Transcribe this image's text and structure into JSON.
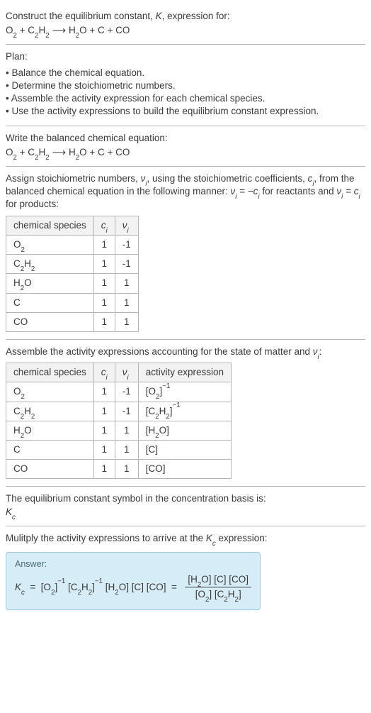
{
  "prompt": {
    "line1_a": "Construct the equilibrium constant, ",
    "line1_K": "K",
    "line1_b": ", expression for:"
  },
  "plan": {
    "heading": "Plan:",
    "items": [
      "Balance the chemical equation.",
      "Determine the stoichiometric numbers.",
      "Assemble the activity expression for each chemical species.",
      "Use the activity expressions to build the equilibrium constant expression."
    ]
  },
  "balanced_heading": "Write the balanced chemical equation:",
  "stoich": {
    "intro_a": "Assign stoichiometric numbers, ",
    "intro_b": ", using the stoichiometric coefficients, ",
    "intro_c": ", from the balanced chemical equation in the following manner: ",
    "intro_d": " for reactants and ",
    "intro_e": " for products:",
    "headers": {
      "species": "chemical species",
      "ci": "c",
      "vi": "ν"
    },
    "rows": [
      {
        "ci": "1",
        "vi": "-1",
        "kind": "O2"
      },
      {
        "ci": "1",
        "vi": "-1",
        "kind": "C2H2"
      },
      {
        "ci": "1",
        "vi": "1",
        "kind": "H2O"
      },
      {
        "ci": "1",
        "vi": "1",
        "kind": "C"
      },
      {
        "ci": "1",
        "vi": "1",
        "kind": "CO"
      }
    ]
  },
  "activity": {
    "intro_a": "Assemble the activity expressions accounting for the state of matter and ",
    "intro_b": ":",
    "headers": {
      "species": "chemical species",
      "ci": "c",
      "vi": "ν",
      "act": "activity expression"
    },
    "rows": [
      {
        "ci": "1",
        "vi": "-1"
      },
      {
        "ci": "1",
        "vi": "-1"
      },
      {
        "ci": "1",
        "vi": "1"
      },
      {
        "ci": "1",
        "vi": "1"
      },
      {
        "ci": "1",
        "vi": "1"
      }
    ]
  },
  "kc_intro": "The equilibrium constant symbol in the concentration basis is:",
  "multiply_intro_a": "Mulitply the activity expressions to arrive at the ",
  "multiply_intro_b": " expression:",
  "answer_label": "Answer:",
  "chart_data": {
    "type": "table",
    "title": "Stoichiometric numbers and activity expressions",
    "reaction": "O2 + C2H2 -> H2O + C + CO",
    "species": [
      {
        "name": "O2",
        "c_i": 1,
        "nu_i": -1,
        "activity_expression": "[O2]^(-1)"
      },
      {
        "name": "C2H2",
        "c_i": 1,
        "nu_i": -1,
        "activity_expression": "[C2H2]^(-1)"
      },
      {
        "name": "H2O",
        "c_i": 1,
        "nu_i": 1,
        "activity_expression": "[H2O]"
      },
      {
        "name": "C",
        "c_i": 1,
        "nu_i": 1,
        "activity_expression": "[C]"
      },
      {
        "name": "CO",
        "c_i": 1,
        "nu_i": 1,
        "activity_expression": "[CO]"
      }
    ],
    "Kc_expression": "K_c = [O2]^(-1) [C2H2]^(-1) [H2O] [C] [CO] = ([H2O][C][CO]) / ([O2][C2H2])"
  }
}
